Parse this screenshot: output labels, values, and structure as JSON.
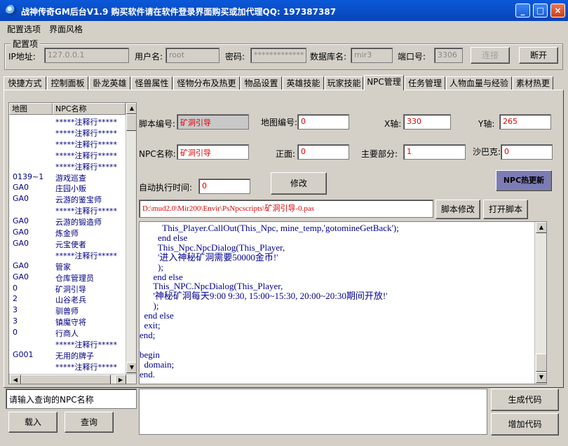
{
  "window": {
    "title": "战神传奇GM后台V1.9     购买软件请在软件登录界面购买或加代理QQ: 197387387",
    "btn_min": "_",
    "btn_max": "□",
    "btn_close": "×"
  },
  "menu": [
    "配置选项",
    "界面风格"
  ],
  "config": {
    "legend": "配置项",
    "ip_label": "IP地址:",
    "ip_value": "127.0.0.1",
    "user_label": "用户名:",
    "user_value": "root",
    "pwd_label": "密码:",
    "pwd_value": "*************",
    "db_label": "数据库名:",
    "db_value": "mir3",
    "port_label": "端口号:",
    "port_value": "3306",
    "connect_label": "连接",
    "disconnect_label": "断开"
  },
  "tabs": [
    "快捷方式",
    "控制面板",
    "卧龙英雄",
    "怪兽属性",
    "怪物分布及热更",
    "物品设置",
    "英雄技能",
    "玩家技能",
    "NPC管理",
    "任务管理",
    "人物血量与经验",
    "素材热更"
  ],
  "active_tab": "NPC管理",
  "npc_list": {
    "col_map": "地图",
    "col_name": "NPC名称",
    "rows": [
      {
        "map": "",
        "name": "*****注释行*****"
      },
      {
        "map": "",
        "name": "*****注释行*****"
      },
      {
        "map": "",
        "name": "*****注释行*****"
      },
      {
        "map": "",
        "name": "*****注释行*****"
      },
      {
        "map": "",
        "name": "*****注释行*****"
      },
      {
        "map": "0139~1",
        "name": "游戏巡查"
      },
      {
        "map": "GA0",
        "name": "庄园小贩"
      },
      {
        "map": "GA0",
        "name": "云游的鉴宝师"
      },
      {
        "map": "",
        "name": "*****注释行*****"
      },
      {
        "map": "GA0",
        "name": "云游的锻造师"
      },
      {
        "map": "GA0",
        "name": "炼金师"
      },
      {
        "map": "GA0",
        "name": "元宝使者"
      },
      {
        "map": "",
        "name": "*****注释行*****"
      },
      {
        "map": "GA0",
        "name": "管家"
      },
      {
        "map": "GA0",
        "name": "仓库管理员"
      },
      {
        "map": "0",
        "name": "矿洞引导"
      },
      {
        "map": "2",
        "name": "山谷老兵"
      },
      {
        "map": "3",
        "name": "驯兽师"
      },
      {
        "map": "3",
        "name": "镇魔守将"
      },
      {
        "map": "0",
        "name": "行商人"
      },
      {
        "map": "",
        "name": "*****注释行*****"
      },
      {
        "map": "G001",
        "name": "无用的牌子"
      },
      {
        "map": "",
        "name": "*****注释行*****"
      }
    ]
  },
  "form": {
    "script_no_label": "脚本编号:",
    "script_no_value": "矿洞引导",
    "map_no_label": "地图编号:",
    "map_no_value": "0",
    "x_label": "X轴:",
    "x_value": "330",
    "y_label": "Y轴:",
    "y_value": "265",
    "npc_name_label": "NPC名称:",
    "npc_name_value": "矿洞引导",
    "face_label": "正面:",
    "face_value": "0",
    "main_part_label": "主要部分:",
    "main_part_value": "1",
    "sabak_label": "沙巴克:",
    "sabak_value": "0",
    "auto_time_label": "自动执行时间:",
    "auto_time_value": "0",
    "modify_label": "修改",
    "hot_update_label": "NPC热更新",
    "script_path": "D:\\mud2.0\\Mir200\\Envir\\PsNpcscripts\\矿洞引导-0.pas",
    "script_modify_label": "脚本修改",
    "open_script_label": "打开脚本"
  },
  "code_lines": [
    "          This_Player.CallOut(This_Npc, mine_temp,'gotomineGetBack');",
    "        end else",
    "        This_Npc.NpcDialog(This_Player,",
    "        '进入神秘矿洞需要50000金币!'",
    "        );",
    "      end else",
    "      This_NPC.NpcDialog(This_Player,",
    "      '神秘矿洞每天9:00 9:30, 15:00~15:30, 20:00~20:30期间开放!'",
    "      );",
    "  end else",
    "  exit;",
    "end;",
    "",
    "begin",
    "  domain;",
    "end."
  ],
  "bottom": {
    "search_placeholder": "请输入查询的NPC名称",
    "load_label": "载入",
    "query_label": "查询",
    "generate_label": "生成代码",
    "add_label": "增加代码"
  }
}
